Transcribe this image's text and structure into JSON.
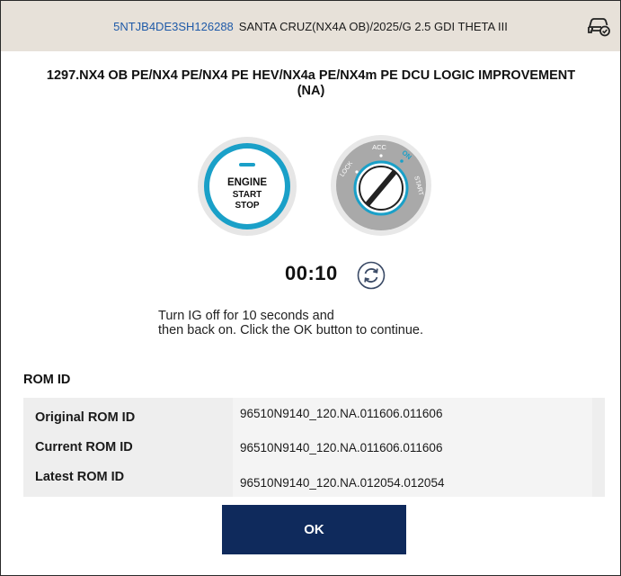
{
  "header": {
    "vin": "5NTJB4DE3SH126288",
    "vehicle": "SANTA CRUZ(NX4A OB)/2025/G 2.5 GDI THETA III",
    "icon": "vehicle-check-icon"
  },
  "title": {
    "line1": "1297.NX4 OB PE/NX4 PE/NX4 PE HEV/NX4a PE/NX4m PE DCU LOGIC IMPROVEMENT",
    "line2": "(NA)"
  },
  "engine_button": {
    "line1": "ENGINE",
    "line2": "START",
    "line3": "STOP"
  },
  "ignition": {
    "lock": "LOCK",
    "acc": "ACC",
    "on": "ON",
    "start": "START"
  },
  "timer": {
    "value": "00:10",
    "icon": "refresh-icon"
  },
  "instructions": {
    "line1": "Turn IG off for 10 seconds and",
    "line2": "then back on. Click the OK button to continue."
  },
  "rom": {
    "heading": "ROM ID",
    "rows": [
      {
        "label": "Original ROM ID",
        "value": "96510N9140_120.NA.011606.011606"
      },
      {
        "label": "Current ROM ID",
        "value": "96510N9140_120.NA.011606.011606"
      },
      {
        "label": "Latest ROM ID",
        "value": "96510N9140_120.NA.012054.012054"
      }
    ]
  },
  "ok_button": {
    "label": "OK"
  },
  "colors": {
    "header_bg": "#e7e1d9",
    "vin_blue": "#1f5aa8",
    "accent_teal": "#1aa0c8",
    "button_navy": "#0f2a5c"
  }
}
